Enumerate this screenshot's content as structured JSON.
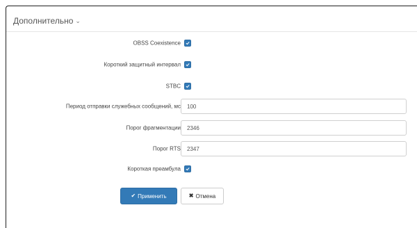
{
  "section": {
    "title": "Дополнительно",
    "chevron_icon": "chevron-down-icon"
  },
  "settings": {
    "obss": {
      "label": "OBSS Coexistence",
      "checked": true
    },
    "short_gi": {
      "label": "Короткий защитный интервал",
      "checked": true
    },
    "stbc": {
      "label": "STBC",
      "checked": true
    },
    "beacon_interval": {
      "label": "Период отправки служебных сообщений, мс",
      "value": "100"
    },
    "frag_threshold": {
      "label": "Порог фрагментации",
      "value": "2346"
    },
    "rts_threshold": {
      "label": "Порог RTS",
      "value": "2347"
    },
    "short_preamble": {
      "label": "Короткая преамбула",
      "checked": true
    }
  },
  "actions": {
    "apply_label": "Применить",
    "apply_icon": "check-icon",
    "cancel_label": "Отмена",
    "cancel_icon": "close-icon"
  },
  "colors": {
    "primary": "#337ab7",
    "border": "#cfcfcf"
  }
}
